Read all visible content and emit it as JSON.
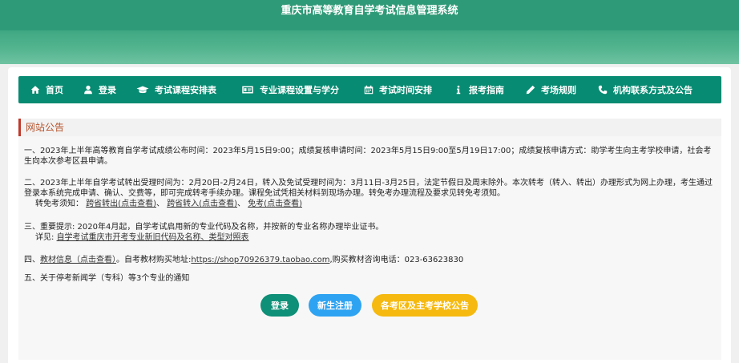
{
  "header": {
    "title": "重庆市高等教育自学考试信息管理系统"
  },
  "nav": [
    {
      "label": "首页",
      "icon": "home-icon"
    },
    {
      "label": "登录",
      "icon": "user-icon"
    },
    {
      "label": "考试课程安排表",
      "icon": "graduation-cap-icon"
    },
    {
      "label": "专业课程设置与学分",
      "icon": "id-card-icon"
    },
    {
      "label": "考试时间安排",
      "icon": "calendar-icon"
    },
    {
      "label": "报考指南",
      "icon": "info-icon"
    },
    {
      "label": "考场规则",
      "icon": "pencil-icon"
    },
    {
      "label": "机构联系方式及公告",
      "icon": "phone-icon"
    }
  ],
  "notice": {
    "title": "网站公告",
    "p1": "一、2023年上半年高等教育自学考试成绩公布时间：2023年5月15日9:00；成绩复核申请时间：2023年5月15日9:00至5月19日17:00；成绩复核申请方式：助学考生向主考学校申请，社会考生向本次参考区县申请。",
    "p2": "二、2023年上半年自学考试转出受理时间为：2月20日-2月24日，转入及免试受理时间为：3月11日-3月25日，法定节假日及周末除外。本次转考（转入、转出）办理形式为网上办理，考生通过登录本系统完成申请、确认、交费等，即可完成转考手续办理。课程免试凭相关材料到现场办理。转免考办理流程及要求见转免考须知。",
    "p2_sub_prefix": "转免考须知：",
    "p2_link1": "跨省转出(点击查看)",
    "p2_sep1": "、",
    "p2_link2": "跨省转入(点击查看)",
    "p2_sep2": "、",
    "p2_link3": "免考(点击查看)",
    "p3": "三、重要提示: 2020年4月起，自学考试启用新的专业代码及名称，并按新的专业名称办理毕业证书。",
    "p3_sub_prefix": "详见:",
    "p3_link": "自学考试重庆市开考专业新旧代码及名称、类型对照表",
    "p4_prefix": "四、",
    "p4_link1": "教材信息（点击查看）",
    "p4_mid": "。自考教材购买地址:",
    "p4_link2": "https://shop70926379.taobao.com",
    "p4_suffix": ",购买教材咨询电话：023-63623830",
    "p5": "五、关于停考新闻学（专科）等3个专业的通知"
  },
  "buttons": {
    "login": "登录",
    "register": "新生注册",
    "announcement": "各考区及主考学校公告"
  },
  "colors": {
    "nav_bg": "#078b72",
    "login_btn": "#0e8f77",
    "register_btn": "#2ea3f2",
    "announcement_btn": "#f5b90f",
    "notice_title": "#b5522a"
  }
}
